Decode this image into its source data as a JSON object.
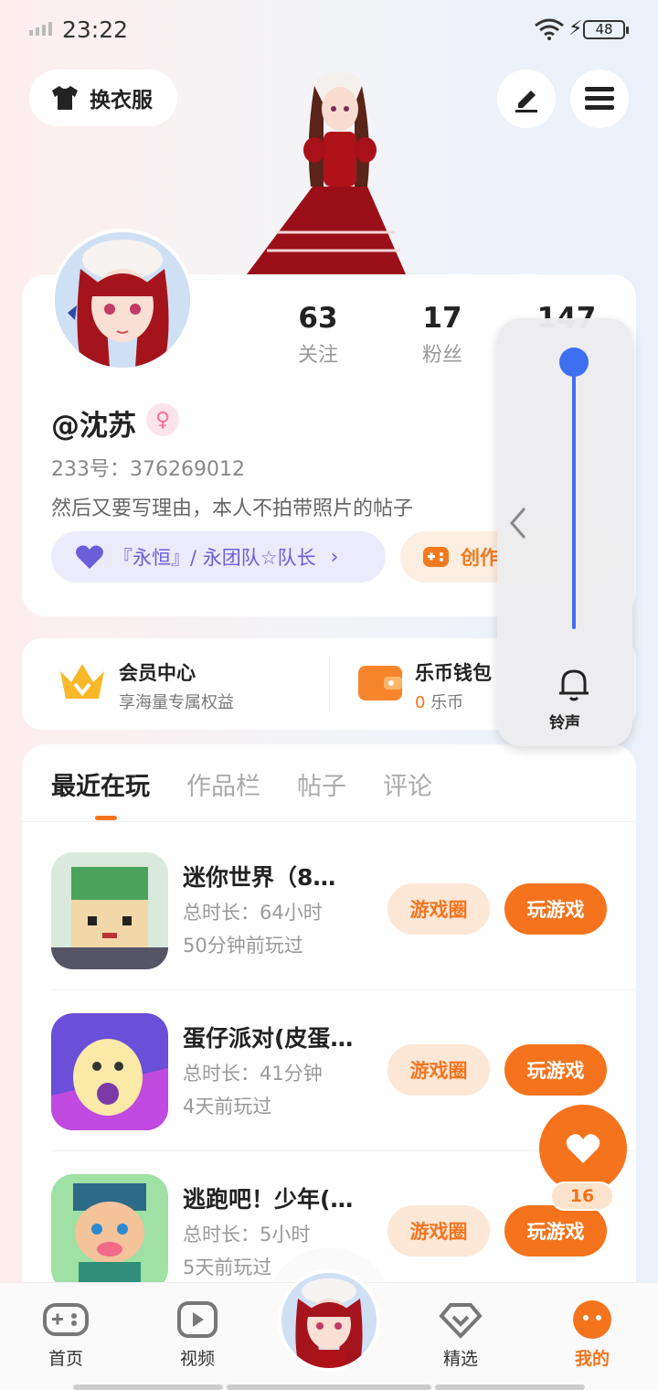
{
  "status": {
    "time": "23:22",
    "battery": "48"
  },
  "header": {
    "outfit_label": "换衣服",
    "edit_icon": "pen-icon",
    "menu_icon": "menu-icon"
  },
  "profile": {
    "stats": [
      {
        "value": "63",
        "label": "关注"
      },
      {
        "value": "17",
        "label": "粉丝"
      },
      {
        "value": "147",
        "label": ""
      }
    ],
    "username": "@沈苏",
    "gender_icon": "female-icon",
    "user_id": "233号：376269012",
    "bio": "然后又要写理由，本人不拍带照片的帖子",
    "team_chip": "『永恒』/ 永团队☆队长",
    "creator_chip": "创作"
  },
  "quick": {
    "member": {
      "title": "会员中心",
      "subtitle": "享海量专属权益"
    },
    "wallet": {
      "title": "乐币钱包",
      "amount": "0",
      "unit": "乐币"
    }
  },
  "tabs": [
    "最近在玩",
    "作品栏",
    "帖子",
    "评论"
  ],
  "games": [
    {
      "name": "迷你世界（8…",
      "duration": "总时长：64小时",
      "last_played": "50分钟前玩过",
      "circle_label": "游戏圈",
      "play_label": "玩游戏"
    },
    {
      "name": "蛋仔派对(皮蛋…",
      "duration": "总时长：41分钟",
      "last_played": "4天前玩过",
      "circle_label": "游戏圈",
      "play_label": "玩游戏"
    },
    {
      "name": "逃跑吧！少年(…",
      "duration": "总时长：5小时",
      "last_played": "5天前玩过",
      "circle_label": "游戏圈",
      "play_label": "玩游戏"
    }
  ],
  "volume": {
    "label": "铃声",
    "level": 1.0
  },
  "like": {
    "count": "16"
  },
  "nav": [
    "首页",
    "视频",
    "精选",
    "我的"
  ],
  "colors": {
    "accent": "#f5731c",
    "slider": "#3e6ff0",
    "team": "#6a5fd8"
  }
}
